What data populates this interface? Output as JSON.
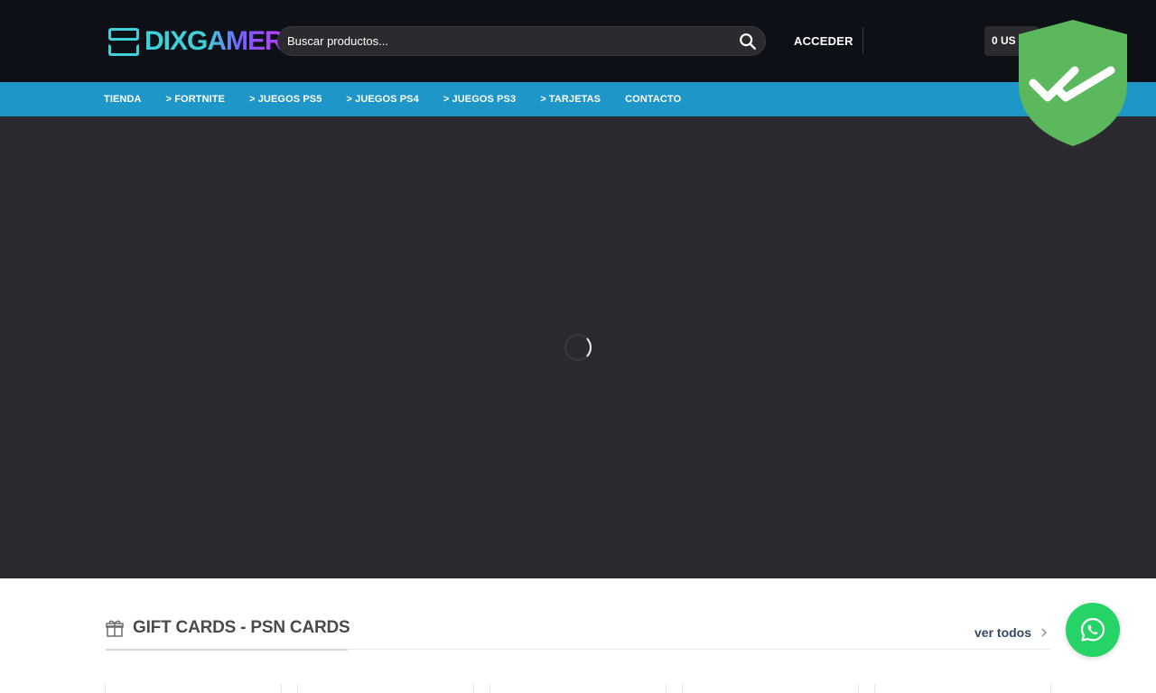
{
  "header": {
    "logo_text": "DIXGAMER",
    "search": {
      "placeholder": "Buscar productos..."
    },
    "login_label": "ACCEDER",
    "cart_label": "0 US"
  },
  "nav": {
    "items": [
      {
        "label": "TIENDA"
      },
      {
        "label": "> FORTNITE"
      },
      {
        "label": "> JUEGOS PS5"
      },
      {
        "label": "> JUEGOS PS4"
      },
      {
        "label": "> JUEGOS PS3"
      },
      {
        "label": "> TARJETAS"
      },
      {
        "label": "CONTACTO"
      }
    ]
  },
  "section": {
    "title": "GIFT CARDS - PSN CARDS",
    "see_all": "ver todos"
  },
  "colors": {
    "header_bg": "#0d1117",
    "nav_bg": "#1e96c8",
    "hero_bg": "#2b2a30",
    "badge_green": "#5cb85c",
    "whatsapp_green": "#25d366"
  },
  "icons": {
    "search": "search-icon",
    "badge": "shield-double-check-icon",
    "section": "gift-icon",
    "chevron": "chevron-right-icon",
    "whatsapp": "whatsapp-icon",
    "loader": "loading-spinner-icon"
  }
}
